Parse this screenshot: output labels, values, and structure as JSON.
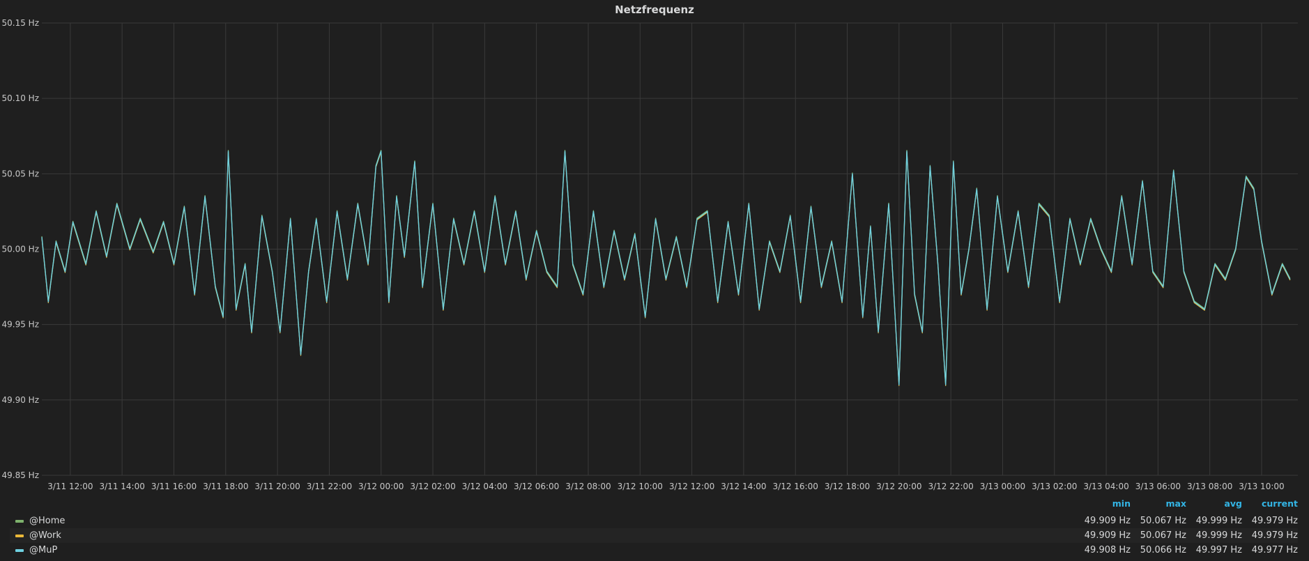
{
  "panel": {
    "title": "Netzfrequenz"
  },
  "chart_data": {
    "type": "line",
    "title": "Netzfrequenz",
    "xlabel": "",
    "ylabel": "",
    "ylim": [
      49.85,
      50.15
    ],
    "yticks": [
      "50.15 Hz",
      "50.10 Hz",
      "50.05 Hz",
      "50.00 Hz",
      "49.95 Hz",
      "49.90 Hz",
      "49.85 Hz"
    ],
    "ytick_values": [
      50.15,
      50.1,
      50.05,
      50.0,
      49.95,
      49.9,
      49.85
    ],
    "x_range_hours": [
      10.9,
      59.4
    ],
    "xticks": [
      "3/11 12:00",
      "3/11 14:00",
      "3/11 16:00",
      "3/11 18:00",
      "3/11 20:00",
      "3/11 22:00",
      "3/12 00:00",
      "3/12 02:00",
      "3/12 04:00",
      "3/12 06:00",
      "3/12 08:00",
      "3/12 10:00",
      "3/12 12:00",
      "3/12 14:00",
      "3/12 16:00",
      "3/12 18:00",
      "3/12 20:00",
      "3/12 22:00",
      "3/13 00:00",
      "3/13 02:00",
      "3/13 04:00",
      "3/13 06:00",
      "3/13 08:00",
      "3/13 10:00"
    ],
    "xtick_hours": [
      12,
      14,
      16,
      18,
      20,
      22,
      24,
      26,
      28,
      30,
      32,
      34,
      36,
      38,
      40,
      42,
      44,
      46,
      48,
      50,
      52,
      54,
      56,
      58
    ],
    "grid": true,
    "legend": "bottom",
    "series": [
      {
        "name": "@Home",
        "color": "#7eb26d"
      },
      {
        "name": "@Work",
        "color": "#eab839"
      },
      {
        "name": "@MuP",
        "color": "#6ed0e0"
      }
    ],
    "x": [
      10.9,
      11.15,
      11.45,
      11.8,
      12.1,
      12.6,
      13.0,
      13.4,
      13.8,
      14.3,
      14.7,
      15.2,
      15.6,
      16.0,
      16.4,
      16.8,
      17.2,
      17.6,
      17.9,
      18.1,
      18.4,
      18.75,
      19.0,
      19.4,
      19.8,
      20.1,
      20.5,
      20.9,
      21.2,
      21.5,
      21.9,
      22.3,
      22.7,
      23.1,
      23.5,
      23.8,
      24.0,
      24.3,
      24.6,
      24.9,
      25.3,
      25.6,
      26.0,
      26.4,
      26.8,
      27.2,
      27.6,
      28.0,
      28.4,
      28.8,
      29.2,
      29.6,
      30.0,
      30.4,
      30.8,
      31.1,
      31.4,
      31.8,
      32.2,
      32.6,
      33.0,
      33.4,
      33.8,
      34.2,
      34.6,
      35.0,
      35.4,
      35.8,
      36.2,
      36.6,
      37.0,
      37.4,
      37.8,
      38.2,
      38.6,
      39.0,
      39.4,
      39.8,
      40.2,
      40.6,
      41.0,
      41.4,
      41.8,
      42.2,
      42.6,
      42.9,
      43.2,
      43.6,
      44.0,
      44.3,
      44.6,
      44.9,
      45.2,
      45.5,
      45.8,
      46.1,
      46.4,
      46.7,
      47.0,
      47.4,
      47.8,
      48.2,
      48.6,
      49.0,
      49.4,
      49.8,
      50.2,
      50.6,
      51.0,
      51.4,
      51.8,
      52.2,
      52.6,
      53.0,
      53.4,
      53.8,
      54.2,
      54.6,
      55.0,
      55.4,
      55.8,
      56.2,
      56.6,
      57.0,
      57.4,
      57.7,
      58.0,
      58.4,
      58.8,
      59.1,
      59.4
    ],
    "values": [
      50.008,
      49.965,
      50.005,
      49.985,
      50.018,
      49.99,
      50.025,
      49.995,
      50.03,
      50.0,
      50.02,
      49.998,
      50.018,
      49.99,
      50.028,
      49.97,
      50.035,
      49.975,
      49.955,
      50.065,
      49.96,
      49.99,
      49.945,
      50.022,
      49.985,
      49.945,
      50.02,
      49.93,
      49.985,
      50.02,
      49.965,
      50.025,
      49.98,
      50.03,
      49.99,
      50.055,
      50.065,
      49.965,
      50.035,
      49.995,
      50.058,
      49.975,
      50.03,
      49.96,
      50.02,
      49.99,
      50.025,
      49.985,
      50.035,
      49.99,
      50.025,
      49.98,
      50.012,
      49.985,
      49.975,
      50.065,
      49.99,
      49.97,
      50.025,
      49.975,
      50.012,
      49.98,
      50.01,
      49.955,
      50.02,
      49.98,
      50.008,
      49.975,
      50.02,
      50.025,
      49.965,
      50.018,
      49.97,
      50.03,
      49.96,
      50.005,
      49.985,
      50.022,
      49.965,
      50.028,
      49.975,
      50.005,
      49.965,
      50.05,
      49.955,
      50.015,
      49.945,
      50.03,
      49.91,
      50.065,
      49.97,
      49.945,
      50.055,
      49.99,
      49.91,
      50.058,
      49.97,
      50.0,
      50.04,
      49.96,
      50.035,
      49.985,
      50.025,
      49.975,
      50.03,
      50.022,
      49.965,
      50.02,
      49.99,
      50.02,
      50.0,
      49.985,
      50.035,
      49.99,
      50.045,
      49.985,
      49.975,
      50.052,
      49.985,
      49.965,
      49.96,
      49.99,
      49.98,
      50.0,
      50.048,
      50.04,
      50.005,
      49.97,
      49.99,
      49.98
    ]
  },
  "legend": {
    "headers": {
      "min": "min",
      "max": "max",
      "avg": "avg",
      "current": "current"
    },
    "rows": [
      {
        "name": "@Home",
        "min": "49.909 Hz",
        "max": "50.067 Hz",
        "avg": "49.999 Hz",
        "current": "49.979 Hz"
      },
      {
        "name": "@Work",
        "min": "49.909 Hz",
        "max": "50.067 Hz",
        "avg": "49.999 Hz",
        "current": "49.979 Hz"
      },
      {
        "name": "@MuP",
        "min": "49.908 Hz",
        "max": "50.066 Hz",
        "avg": "49.997 Hz",
        "current": "49.977 Hz"
      }
    ]
  }
}
